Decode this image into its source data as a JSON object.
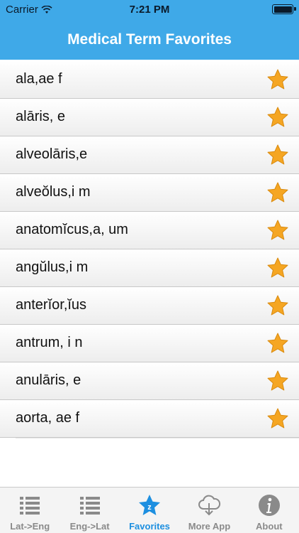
{
  "status": {
    "carrier": "Carrier",
    "time": "7:21 PM"
  },
  "nav": {
    "title": "Medical Term Favorites"
  },
  "favorites": [
    "ala,ae f",
    "alāris, e",
    "alveolāris,e",
    "alveŏlus,i m",
    "anatomĭcus,a, um",
    "angŭlus,i m",
    "anterĭor,ĭus",
    "antrum, i n",
    "anulāris, e",
    "aorta, ae f"
  ],
  "tabs": [
    {
      "label": "Lat->Eng",
      "icon": "list-icon"
    },
    {
      "label": "Eng->Lat",
      "icon": "list-icon"
    },
    {
      "label": "Favorites",
      "icon": "favorites-star-icon",
      "active": true
    },
    {
      "label": "More App",
      "icon": "cloud-download-icon"
    },
    {
      "label": "About",
      "icon": "info-icon"
    }
  ],
  "colors": {
    "accent": "#3fa9e8",
    "star": "#f5a623",
    "tab_active": "#1d8fe0"
  }
}
